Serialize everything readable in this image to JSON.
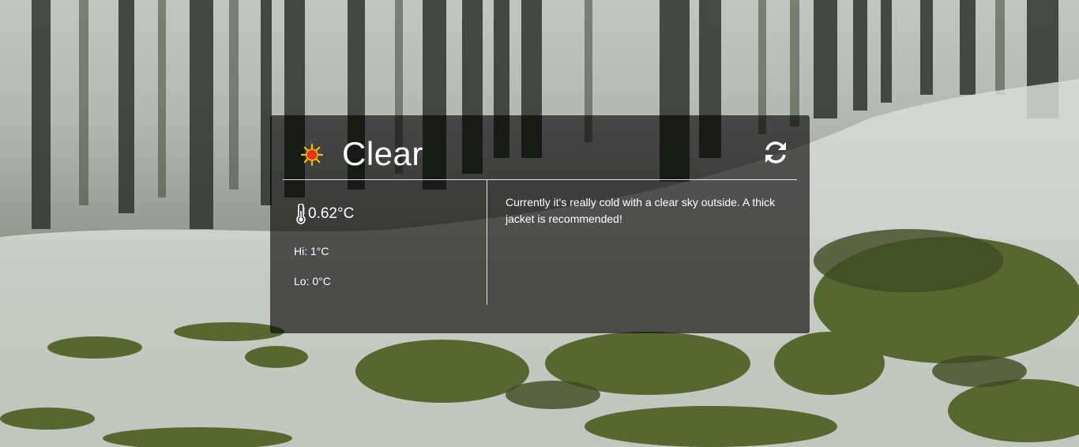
{
  "weather": {
    "condition": "Clear",
    "condition_icon": "sun-icon",
    "temperature": "0.62°C",
    "temperature_icon": "thermometer-icon",
    "hi": "Hi: 1°C",
    "lo": "Lo: 0°C",
    "description": "Currently it's really cold with a clear sky outside. A thick jacket is recommended!",
    "refresh_icon": "refresh-icon"
  },
  "colors": {
    "card_background": "#000000",
    "text": "#ffffff",
    "sun": "#e8331c",
    "sun_rays": "#f2b90f"
  }
}
